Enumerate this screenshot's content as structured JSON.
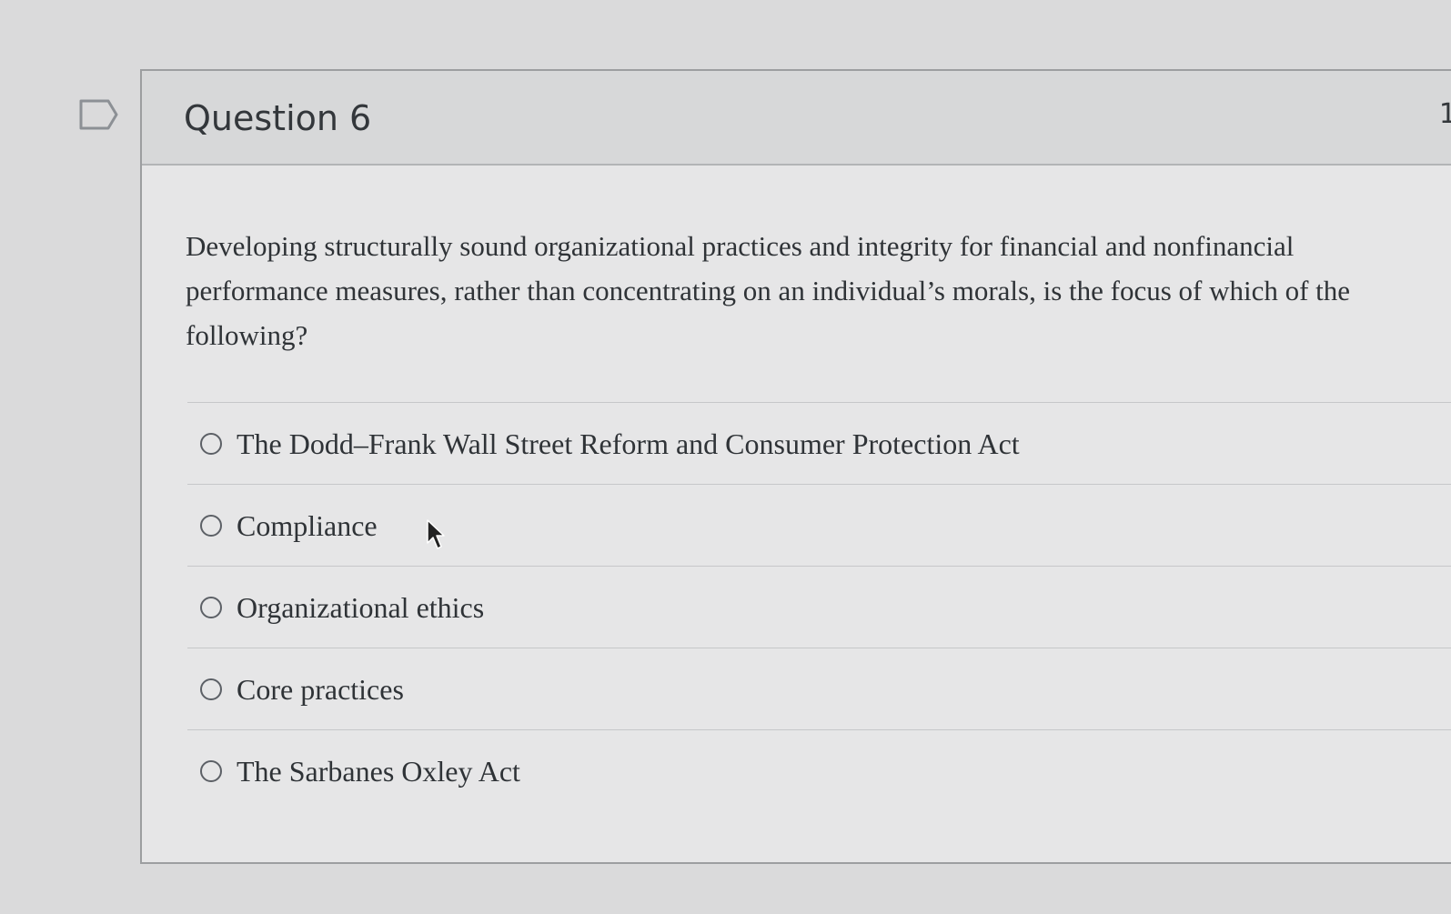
{
  "question": {
    "title": "Question 6",
    "points_partial": "1",
    "text": "Developing structurally sound organizational practices and integrity for financial and nonfinancial performance measures, rather than concentrating on an individual’s morals, is the focus of which of the following?",
    "answers": [
      {
        "label": "The Dodd–Frank Wall Street Reform and Consumer Protection Act",
        "selected": false
      },
      {
        "label": "Compliance",
        "selected": false
      },
      {
        "label": "Organizational ethics",
        "selected": false
      },
      {
        "label": "Core practices",
        "selected": false
      },
      {
        "label": "The Sarbanes Oxley Act",
        "selected": false
      }
    ]
  },
  "icons": {
    "flag": "flag-icon",
    "cursor": "mouse-pointer-icon"
  },
  "colors": {
    "page_background": "#dadadb",
    "card_background": "#e6e6e7",
    "header_background": "#d7d8d9",
    "text": "#2f3337"
  }
}
